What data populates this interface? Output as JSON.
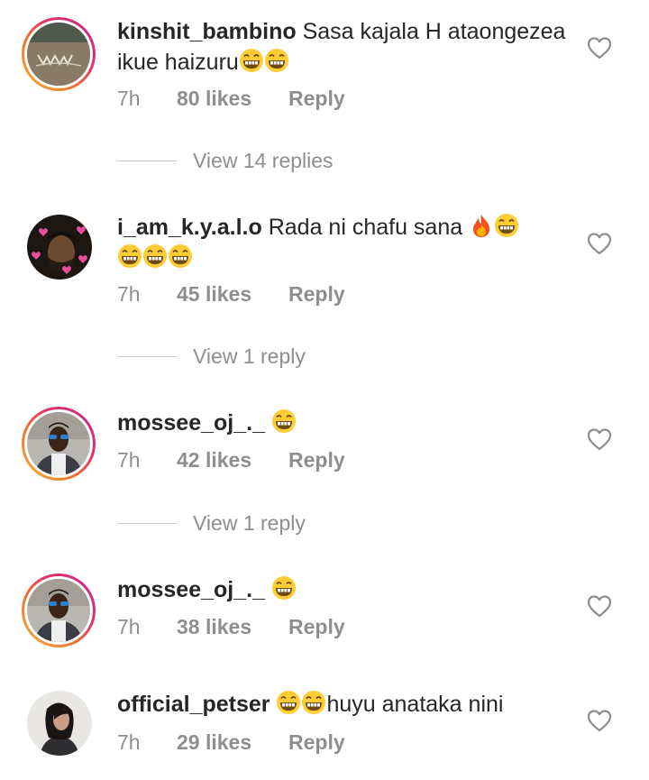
{
  "comments": [
    {
      "username": "kinshit_bambino",
      "text_before": "Sasa kajala H ataongezea ikue haizuru",
      "emoji_after": "😁😁",
      "time": "7h",
      "likes": "80 likes",
      "reply": "Reply",
      "view_replies": "View 14 replies"
    },
    {
      "username": "i_am_k.y.a.l.o",
      "text_before": "Rada ni chafu sana",
      "emoji_after": "🔥😁😁😁😁",
      "time": "7h",
      "likes": "45 likes",
      "reply": "Reply",
      "view_replies": "View 1 reply"
    },
    {
      "username": "mossee_oj_._",
      "text_before": "",
      "emoji_after": "😁",
      "time": "7h",
      "likes": "42 likes",
      "reply": "Reply",
      "view_replies": "View 1 reply"
    },
    {
      "username": "mossee_oj_._",
      "text_before": "",
      "emoji_after": "😁",
      "time": "7h",
      "likes": "38 likes",
      "reply": "Reply"
    },
    {
      "username": "official_petser",
      "emoji_before": "😁😁",
      "text_after": "huyu anataka nini",
      "time": "7h",
      "likes": "29 likes",
      "reply": "Reply"
    }
  ],
  "icons": {
    "heart": "heart-outline-icon",
    "grin": "grinning-emoji",
    "fire": "fire-emoji"
  },
  "colors": {
    "text": "#262626",
    "muted": "#8e8e8e",
    "story_ring_start": "#f7b23b",
    "story_ring_end": "#c22b8e"
  }
}
